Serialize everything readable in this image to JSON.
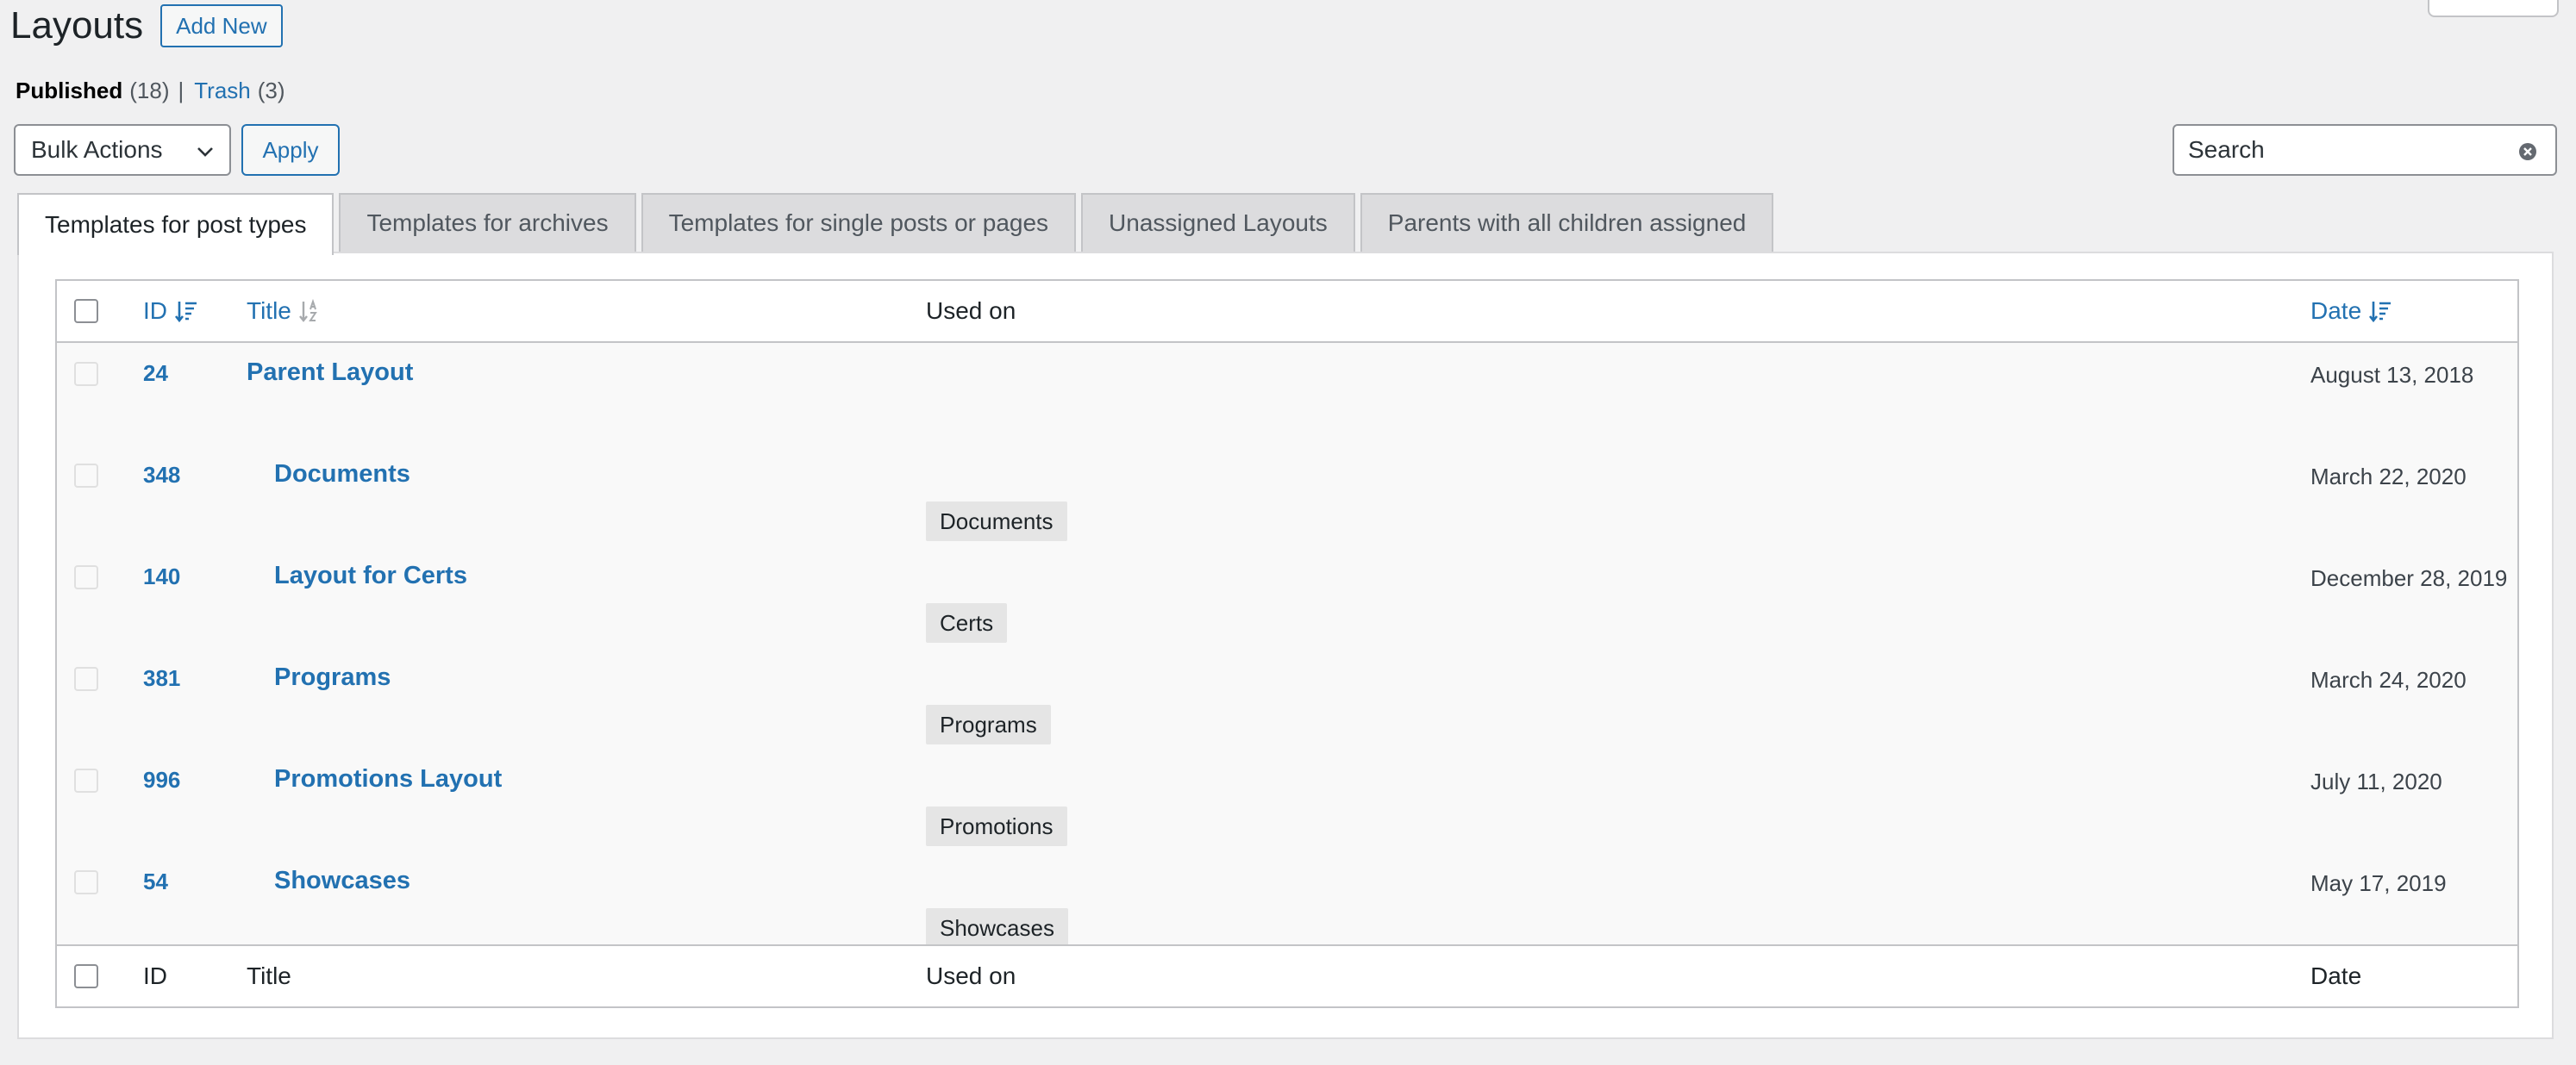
{
  "header": {
    "title": "Layouts",
    "add_new": "Add New"
  },
  "filters": {
    "published_label": "Published",
    "published_count": "(18)",
    "separator": "|",
    "trash_label": "Trash",
    "trash_count": "(3)"
  },
  "bulk": {
    "selected": "Bulk Actions",
    "apply": "Apply"
  },
  "search": {
    "placeholder": "Search"
  },
  "tabs": [
    {
      "label": "Templates for post types",
      "active": true
    },
    {
      "label": "Templates for archives"
    },
    {
      "label": "Templates for single posts or pages"
    },
    {
      "label": "Unassigned Layouts"
    },
    {
      "label": "Parents with all children assigned"
    }
  ],
  "table": {
    "headers": {
      "id": "ID",
      "title": "Title",
      "used_on": "Used on",
      "date": "Date"
    },
    "rows": [
      {
        "id": "24",
        "title": "Parent Layout",
        "used_on": "",
        "date": "August 13, 2018"
      },
      {
        "id": "348",
        "title": "Documents",
        "used_on": "Documents",
        "date": "March 22, 2020"
      },
      {
        "id": "140",
        "title": "Layout for Certs",
        "used_on": "Certs",
        "date": "December 28, 2019"
      },
      {
        "id": "381",
        "title": "Programs",
        "used_on": "Programs",
        "date": "March 24, 2020"
      },
      {
        "id": "996",
        "title": "Promotions Layout",
        "used_on": "Promotions",
        "date": "July 11, 2020"
      },
      {
        "id": "54",
        "title": "Showcases",
        "used_on": "Showcases",
        "date": "May 17, 2019"
      }
    ]
  },
  "colors": {
    "accent": "#2271b1",
    "background": "#f0f0f1",
    "text": "#1d2327"
  }
}
